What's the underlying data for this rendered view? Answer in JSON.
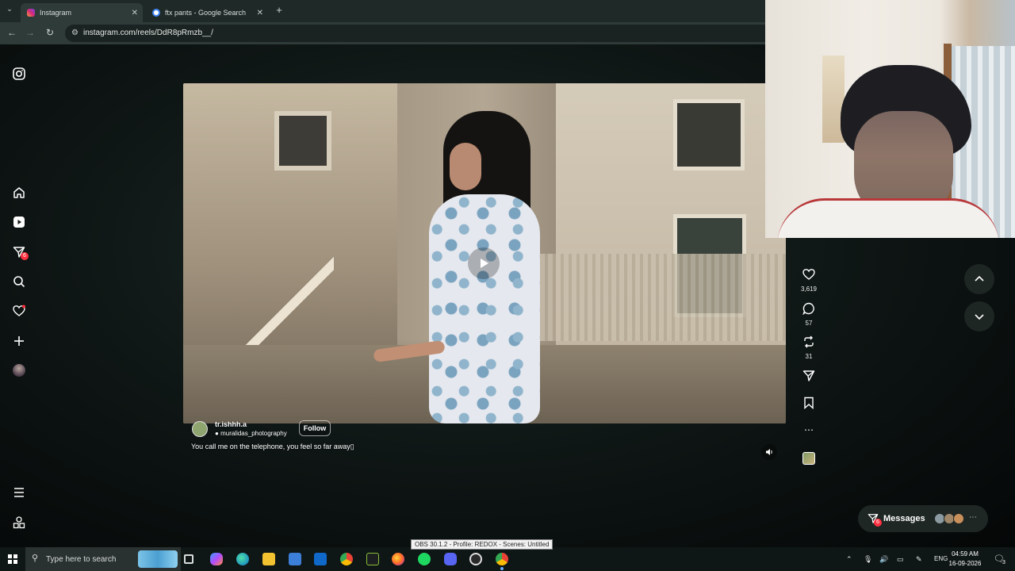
{
  "browser": {
    "tabs": [
      {
        "label": "Instagram",
        "active": true
      },
      {
        "label": "ftx pants - Google Search",
        "active": false
      }
    ],
    "new_tab_symbol": "+",
    "url": "instagram.com/reels/DdR8pRmzb__/"
  },
  "sidebar": {
    "notifications_badge": "6",
    "items": [
      "instagram-logo-icon",
      "home-icon",
      "reels-icon",
      "direct-messages-icon",
      "search-icon",
      "notifications-heart-icon",
      "create-plus-icon",
      "profile-avatar",
      "menu-icon",
      "more-apps-icon"
    ]
  },
  "reel": {
    "username": "tr.ishhh.a",
    "audio": "muralidas_photography",
    "follow_label": "Follow",
    "caption": "You call me on the telephone, you feel so far away▯",
    "likes": "3,619",
    "comments": "57",
    "reposts": "31"
  },
  "messages": {
    "label": "Messages",
    "badge": "6"
  },
  "taskbar": {
    "search_placeholder": "Type here to search",
    "language": "ENG",
    "time": "04:59 AM",
    "date": "16-09-2026",
    "notification_count": "3",
    "tooltip": "OBS 30.1.2 - Profile: REDOX - Scenes: Untitled"
  },
  "colors": {
    "badge_red": "#ff3040",
    "page_bg": "#0d1413",
    "taskbar_bg": "#0f1616"
  }
}
